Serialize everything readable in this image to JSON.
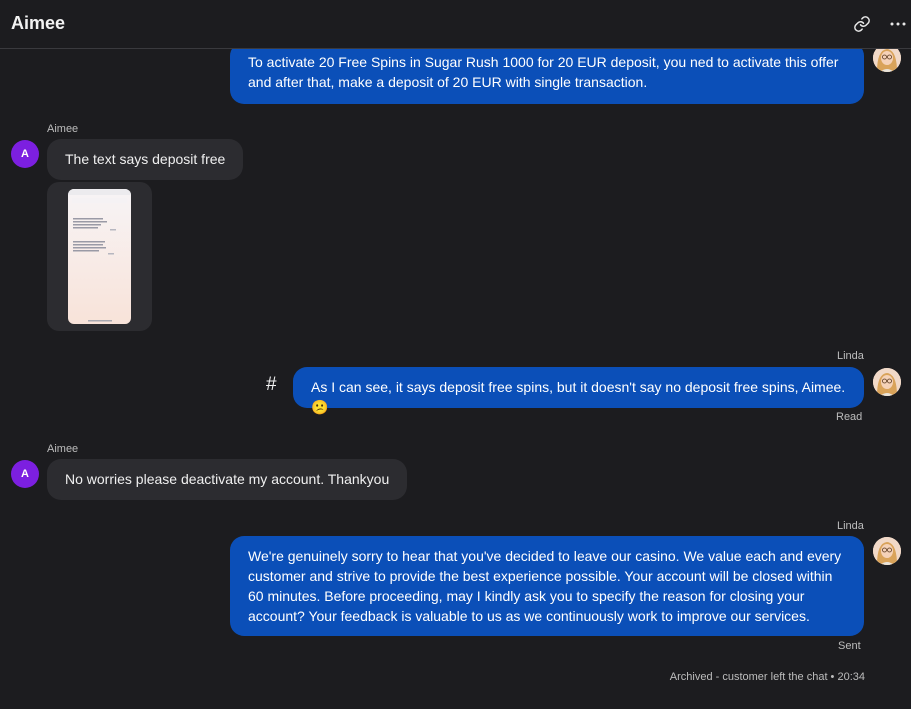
{
  "header": {
    "title": "Aimee",
    "link_icon": "link-icon",
    "more_icon": "more-horizontal-icon"
  },
  "messages": [
    {
      "text": "To activate 20 Free Spins in Sugar Rush 1000 for 20 EUR deposit, you ned to activate this offer and after that, make a deposit of 20 EUR with single transaction."
    },
    {
      "sender": "Aimee",
      "avatar": "A",
      "text": "The text says deposit free",
      "attachment": "image-attachment"
    },
    {
      "sender": "Linda",
      "text": "As I can see, it says deposit free spins, but it doesn't say no deposit free spins, Aimee. 😕",
      "status": "Read",
      "tag_icon": "#"
    },
    {
      "sender": "Aimee",
      "avatar": "A",
      "text": "No worries please deactivate my account. Thankyou"
    },
    {
      "sender": "Linda",
      "text": "We're genuinely sorry to hear that you've decided to leave our casino. We value each and every customer and strive to provide the best experience possible. Your account will be closed within 60 minutes. Before proceeding, may I kindly ask you to specify the reason for closing your account? Your feedback is valuable to us as we continuously work to improve our services.",
      "status": "Sent"
    }
  ],
  "footer": {
    "note": "Archived - customer left the chat • 20:34"
  },
  "colors": {
    "background": "#1c1c1f",
    "outgoing_bubble": "#0b4fb8",
    "incoming_bubble": "#2c2c30",
    "avatar_a": "#7c1fe0"
  }
}
